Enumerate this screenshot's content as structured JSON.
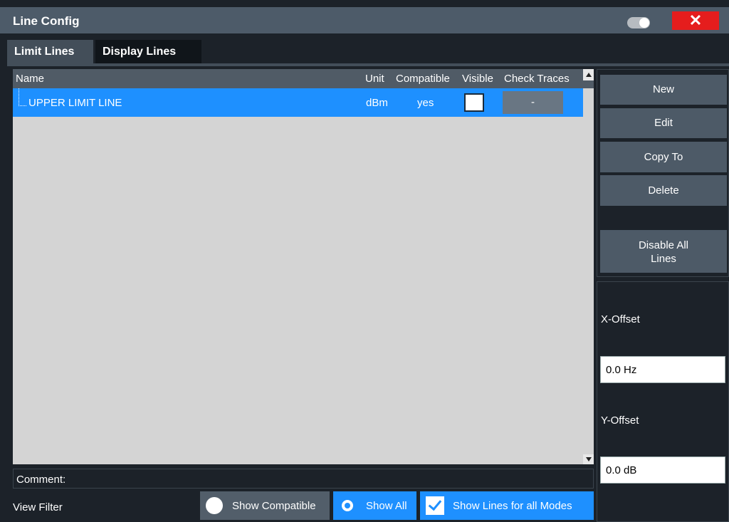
{
  "dialog": {
    "title": "Line Config",
    "close_label": "✕"
  },
  "tabs": [
    {
      "label": "Limit Lines",
      "active": true
    },
    {
      "label": "Display Lines",
      "active": false
    }
  ],
  "table": {
    "columns": [
      "Name",
      "Unit",
      "Compatible",
      "Visible",
      "Check Traces"
    ],
    "rows": [
      {
        "name": "UPPER LIMIT LINE",
        "unit": "dBm",
        "compatible": "yes",
        "visible": false,
        "check_traces": "-"
      }
    ]
  },
  "comment": {
    "label": "Comment:"
  },
  "view_filter": {
    "label": "View Filter",
    "show_compatible": "Show Compatible",
    "show_all": "Show All",
    "show_lines_all_modes": "Show Lines for all Modes",
    "selected": "Show All",
    "all_modes_checked": true
  },
  "side_buttons": {
    "new": "New",
    "edit": "Edit",
    "copy_to": "Copy To",
    "delete": "Delete",
    "disable_all": "Disable All Lines"
  },
  "offsets": {
    "x_label": "X-Offset",
    "x_value": "0.0 Hz",
    "y_label": "Y-Offset",
    "y_value": "0.0 dB"
  },
  "colors": {
    "accent": "#1e90ff",
    "close": "#e51d1d",
    "titlebar": "#4d5b69"
  },
  "icons": [
    "toggle-icon",
    "close-icon",
    "tree-branch-icon",
    "scroll-up-arrow-icon",
    "scroll-down-arrow-icon",
    "radio-icon",
    "checkbox-icon"
  ]
}
